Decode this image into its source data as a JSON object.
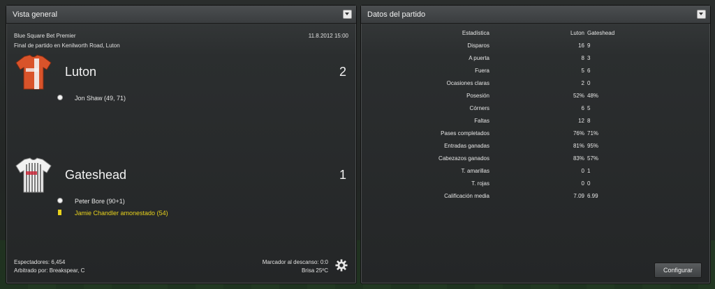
{
  "overview": {
    "title": "Vista general",
    "competition": "Blue Square Bet Premier",
    "datetime": "11.8.2012 15:00",
    "venue": "Final de partido en Kenilworth Road, Luton",
    "home": {
      "name": "Luton",
      "score": "2",
      "events": [
        {
          "icon": "goal-ball-icon",
          "text": "Jon Shaw (49, 71)"
        }
      ]
    },
    "away": {
      "name": "Gateshead",
      "score": "1",
      "events": [
        {
          "icon": "goal-ball-icon",
          "text": "Peter Bore (90+1)"
        },
        {
          "icon": "yellow-card-icon",
          "text": "Jamie Chandler amonestado (54)"
        }
      ]
    },
    "attendance": "Espectadores: 6,454",
    "referee": "Arbitrado por: Breakspear, C",
    "halftime": "Marcador al descanso: 0:0",
    "weather": "Brisa 25ºC"
  },
  "stats": {
    "title": "Datos del partido",
    "header": {
      "label": "Estadística",
      "home": "Luton",
      "away": "Gateshead"
    },
    "rows": [
      {
        "label": "Disparos",
        "home": "16",
        "away": "9"
      },
      {
        "label": "A puerta",
        "home": "8",
        "away": "3"
      },
      {
        "label": "Fuera",
        "home": "5",
        "away": "6"
      },
      {
        "label": "Ocasiones claras",
        "home": "2",
        "away": "0"
      },
      {
        "label": "Posesión",
        "home": "52%",
        "away": "48%"
      },
      {
        "label": "Córners",
        "home": "6",
        "away": "5"
      },
      {
        "label": "Faltas",
        "home": "12",
        "away": "8"
      },
      {
        "label": "Pases completados",
        "home": "76%",
        "away": "71%"
      },
      {
        "label": "Entradas ganadas",
        "home": "81%",
        "away": "95%"
      },
      {
        "label": "Cabezazos ganados",
        "home": "83%",
        "away": "57%"
      },
      {
        "label": "T. amarillas",
        "home": "0",
        "away": "1"
      },
      {
        "label": "T. rojas",
        "home": "0",
        "away": "0"
      },
      {
        "label": "Calificación media",
        "home": "7.09",
        "away": "6.99"
      }
    ],
    "configure_label": "Configurar"
  },
  "colors": {
    "home_shirt": "#d9532a",
    "away_shirt": "#f2f2f2",
    "yellow_card": "#e8d21c"
  }
}
